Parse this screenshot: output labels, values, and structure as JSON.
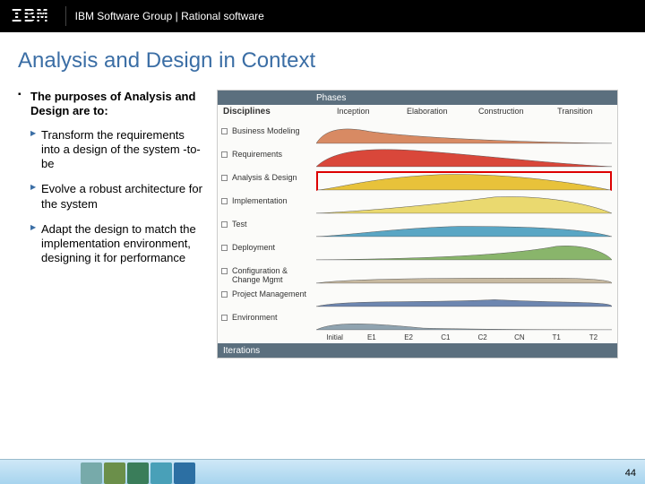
{
  "header": {
    "logo_text": "IBM",
    "group_text": "IBM Software Group | Rational software"
  },
  "slide": {
    "title": "Analysis and Design in Context",
    "heading": "The purposes of Analysis and Design are to:",
    "bullets": [
      "Transform the requirements into a design of the system -to-be",
      "Evolve a robust architecture for the system",
      "Adapt the design to match the implementation environment, designing it for performance"
    ]
  },
  "diagram": {
    "phases_title": "Phases",
    "disciplines_title": "Disciplines",
    "iterations_title": "Iterations",
    "phases": [
      "Inception",
      "Elaboration",
      "Construction",
      "Transition"
    ],
    "disciplines": [
      "Business Modeling",
      "Requirements",
      "Analysis & Design",
      "Implementation",
      "Test",
      "Deployment",
      "Configuration & Change Mgmt",
      "Project Management",
      "Environment"
    ],
    "highlight_index": 2,
    "iterations": [
      "Initial",
      "E1",
      "E2",
      "C1",
      "C2",
      "CN",
      "T1",
      "T2"
    ],
    "colors": [
      "#d88a63",
      "#d9473a",
      "#e8c23a",
      "#ead96f",
      "#5aa6c4",
      "#89b56b",
      "#c7b9a0",
      "#6d86b0",
      "#8fa3b0"
    ]
  },
  "footer": {
    "page": "44"
  }
}
